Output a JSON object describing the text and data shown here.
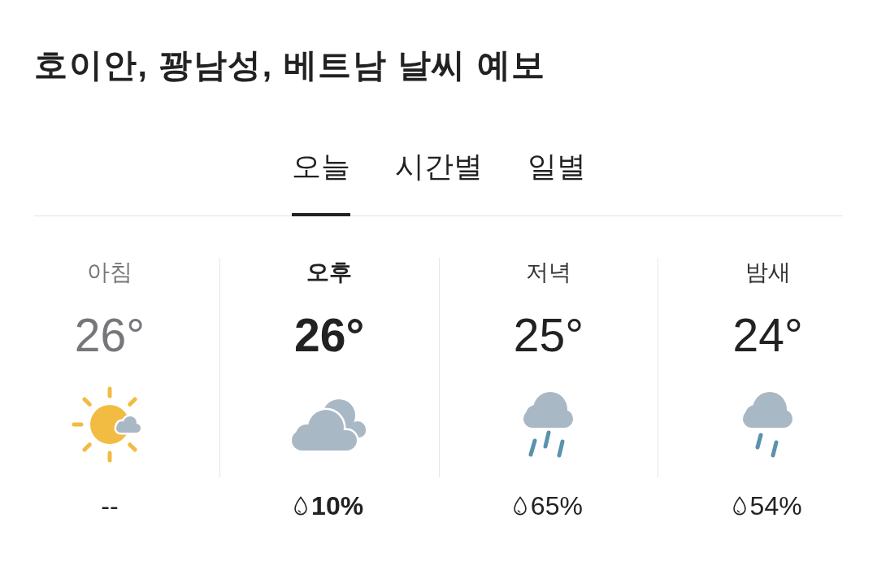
{
  "title": "호이안, 꽝남성, 베트남 날씨 예보",
  "tabs": [
    {
      "label": "오늘",
      "selected": true
    },
    {
      "label": "시간별",
      "selected": false
    },
    {
      "label": "일별",
      "selected": false
    }
  ],
  "periods": [
    {
      "label": "아침",
      "temperature": "26°",
      "kind": "partly-sunny",
      "precipitation": {
        "kind": "none",
        "text": "--"
      },
      "selected": false,
      "past": true
    },
    {
      "label": "오후",
      "temperature": "26°",
      "kind": "cloudy",
      "precipitation": {
        "kind": "chance",
        "text": "10%"
      },
      "selected": true,
      "past": false
    },
    {
      "label": "저녁",
      "temperature": "25°",
      "kind": "rain",
      "precipitation": {
        "kind": "chance",
        "text": "65%"
      },
      "selected": false,
      "past": false
    },
    {
      "label": "밤새",
      "temperature": "24°",
      "kind": "light-rain",
      "precipitation": {
        "kind": "chance",
        "text": "54%"
      },
      "selected": false,
      "past": false
    }
  ]
}
